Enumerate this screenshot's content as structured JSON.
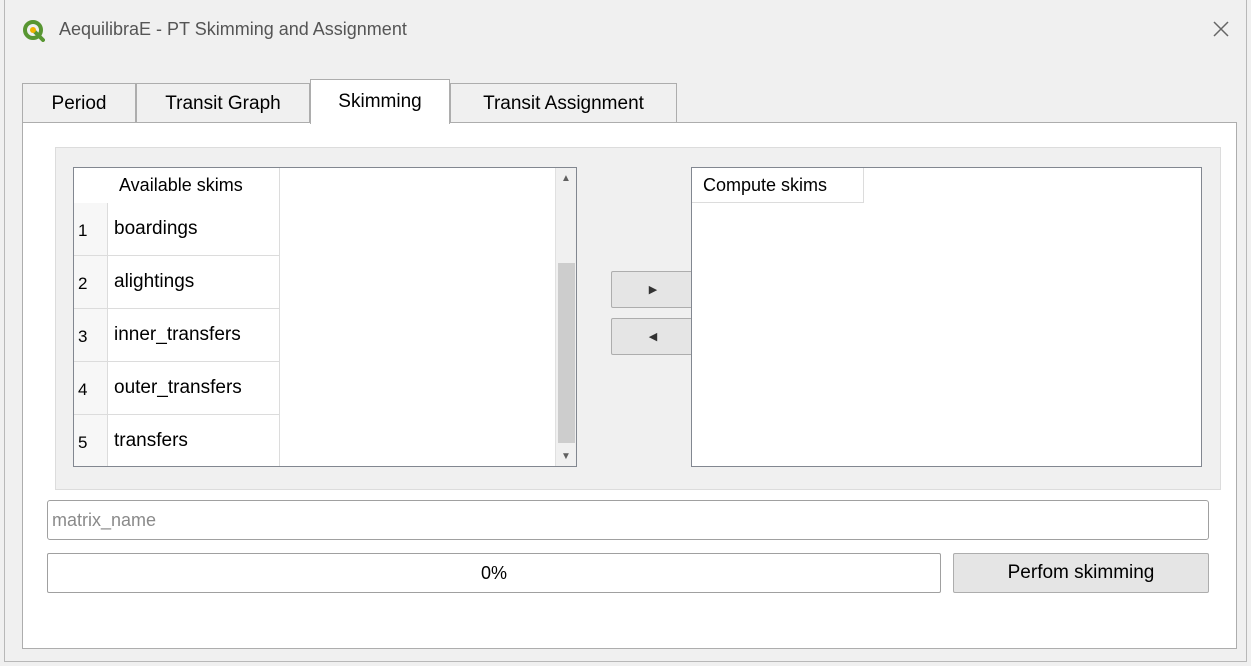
{
  "window": {
    "title": "AequilibraE - PT Skimming and Assignment"
  },
  "tabs": [
    {
      "label": "Period"
    },
    {
      "label": "Transit Graph"
    },
    {
      "label": "Skimming",
      "active": true
    },
    {
      "label": "Transit Assignment"
    }
  ],
  "available_skims": {
    "header": "Available skims",
    "rows": [
      {
        "index": "1",
        "name": "boardings"
      },
      {
        "index": "2",
        "name": "alightings"
      },
      {
        "index": "3",
        "name": "inner_transfers"
      },
      {
        "index": "4",
        "name": "outer_transfers"
      },
      {
        "index": "5",
        "name": "transfers"
      }
    ]
  },
  "compute_skims": {
    "header": "Compute skims"
  },
  "matrix_name": {
    "placeholder": "matrix_name",
    "value": ""
  },
  "progress": {
    "text": "0%",
    "value": 0
  },
  "perform_button": {
    "label": "Perfom skimming"
  },
  "colors": {
    "qgis_icon": "#589632",
    "progress_fill": "#06b025"
  },
  "icons": {
    "app": "qgis-icon",
    "close": "close-icon",
    "scroll_up": "scroll-up-arrow-icon",
    "scroll_down": "scroll-down-arrow-icon",
    "move_right": "arrow-right-icon",
    "move_left": "arrow-left-icon"
  }
}
